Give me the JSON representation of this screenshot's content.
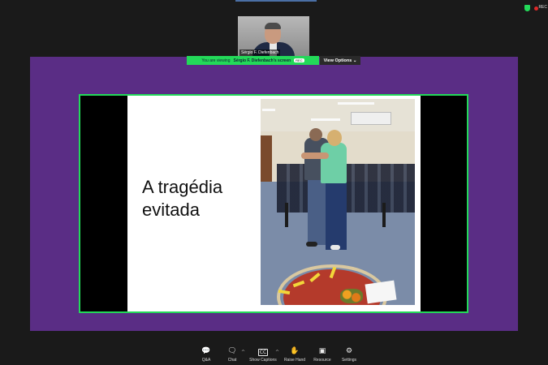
{
  "colors": {
    "accent_green": "#23d959",
    "purple_bg": "#5a2d85",
    "record_red": "#e02828"
  },
  "top_bar": {
    "rec_label": "REC"
  },
  "participant": {
    "name": "Sérgio F. Diefenbach"
  },
  "share_banner": {
    "prefix": "You are viewing",
    "owner": "Sérgio F. Diefenbach's screen",
    "stop_label": "REC",
    "view_options": "View Options ⌄"
  },
  "slide": {
    "title_line1": "A tragédia",
    "title_line2": "evitada"
  },
  "toolbar": {
    "items": [
      {
        "icon": "qa-icon",
        "glyph": "💬",
        "label": "Q&A"
      },
      {
        "icon": "chat-icon",
        "glyph": "🗨",
        "label": "Chat"
      },
      {
        "icon": "captions-icon",
        "glyph": "CC",
        "label": "Show Captions"
      },
      {
        "icon": "raise-hand-icon",
        "glyph": "✋",
        "label": "Raise Hand"
      },
      {
        "icon": "resource-icon",
        "glyph": "▣",
        "label": "Resource"
      },
      {
        "icon": "settings-icon",
        "glyph": "⚙",
        "label": "Settings"
      }
    ]
  }
}
